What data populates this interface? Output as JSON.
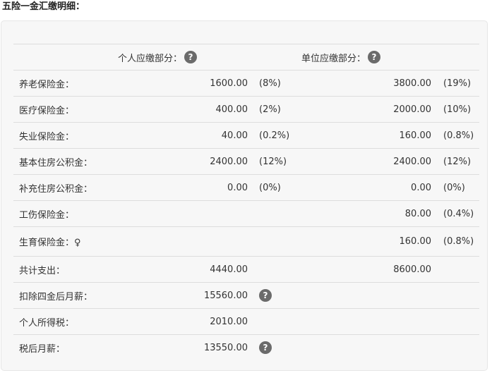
{
  "title": "五险一金汇缴明细：",
  "header": {
    "personal": "个人应缴部分：",
    "company": "单位应缴部分："
  },
  "help_glyph": "?",
  "rows": [
    {
      "label": "养老保险金：",
      "p_val": "1600.00",
      "p_pct": "(8%)",
      "c_val": "3800.00",
      "c_pct": "(19%)"
    },
    {
      "label": "医疗保险金：",
      "p_val": "400.00",
      "p_pct": "(2%)",
      "c_val": "2000.00",
      "c_pct": "(10%)"
    },
    {
      "label": "失业保险金：",
      "p_val": "40.00",
      "p_pct": "(0.2%)",
      "c_val": "160.00",
      "c_pct": "(0.8%)"
    },
    {
      "label": "基本住房公积金：",
      "p_val": "2400.00",
      "p_pct": "(12%)",
      "c_val": "2400.00",
      "c_pct": "(12%)"
    },
    {
      "label": "补充住房公积金：",
      "p_val": "0.00",
      "p_pct": "(0%)",
      "c_val": "0.00",
      "c_pct": "(0%)"
    },
    {
      "label": "工伤保险金：",
      "c_val": "80.00",
      "c_pct": "(0.4%)"
    },
    {
      "label": "生育保险金：♀",
      "c_val": "160.00",
      "c_pct": "(0.8%)"
    }
  ],
  "summary": {
    "total_label": "共计支出：",
    "total_personal": "4440.00",
    "total_company": "8600.00",
    "after_deduct_label": "扣除四金后月薪：",
    "after_deduct_value": "15560.00",
    "tax_label": "个人所得税：",
    "tax_value": "2010.00",
    "net_label": "税后月薪：",
    "net_value": "13550.00"
  }
}
